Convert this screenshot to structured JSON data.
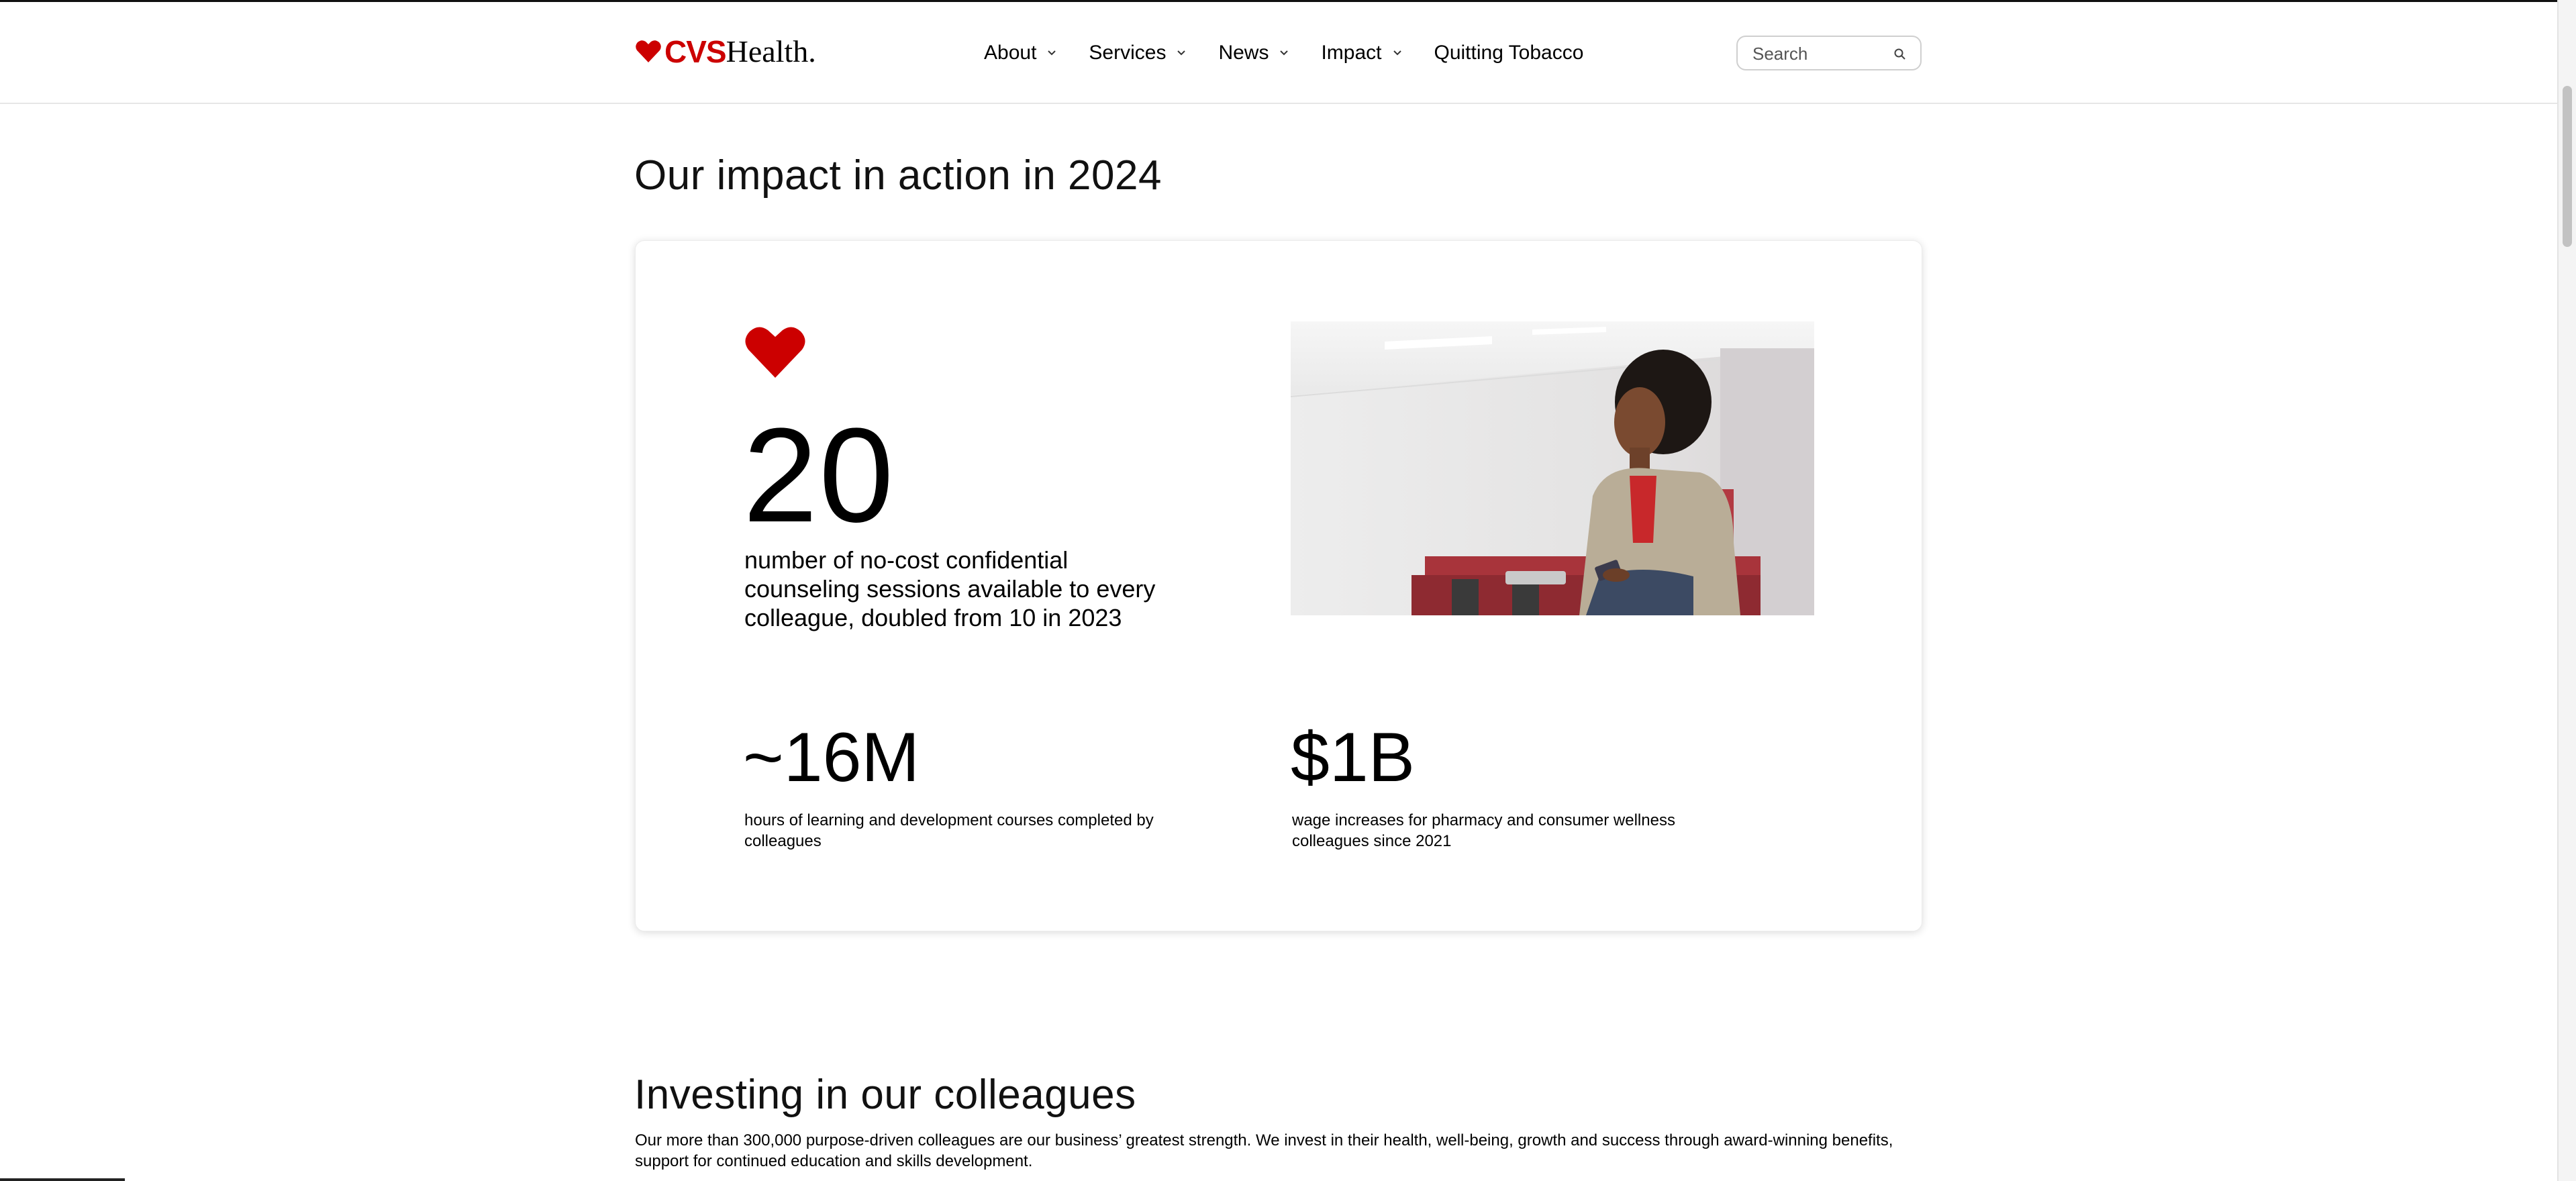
{
  "header": {
    "logo": {
      "brand": "CVS",
      "suffix": "Health",
      "period": "."
    },
    "nav": [
      {
        "label": "About",
        "has_menu": true
      },
      {
        "label": "Services",
        "has_menu": true
      },
      {
        "label": "News",
        "has_menu": true
      },
      {
        "label": "Impact",
        "has_menu": true
      },
      {
        "label": "Quitting Tobacco",
        "has_menu": false
      }
    ],
    "search": {
      "placeholder": "Search",
      "value": ""
    }
  },
  "impact_section": {
    "heading": "Our impact in action in 2024",
    "card": {
      "icon": "heart-icon",
      "featured_stat": {
        "value": "20",
        "description": "number of no-cost confidential counseling sessions available to every colleague, doubled from 10 in 2023"
      },
      "stats": [
        {
          "value": "~16M",
          "description": "hours of learning and development courses completed by colleagues"
        },
        {
          "value": "$1B",
          "description": "wage increases for pharmacy and consumer wellness colleagues since 2021"
        }
      ]
    }
  },
  "colleagues_section": {
    "heading": "Investing in our colleagues",
    "body": "Our more than 300,000 purpose-driven colleagues are our business’ greatest strength. We invest in their health, well-being, growth and success through award-winning benefits, support for continued education and skills development."
  },
  "colors": {
    "brand_red": "#cc0000",
    "text": "#000000",
    "border": "#cfcfcf"
  }
}
